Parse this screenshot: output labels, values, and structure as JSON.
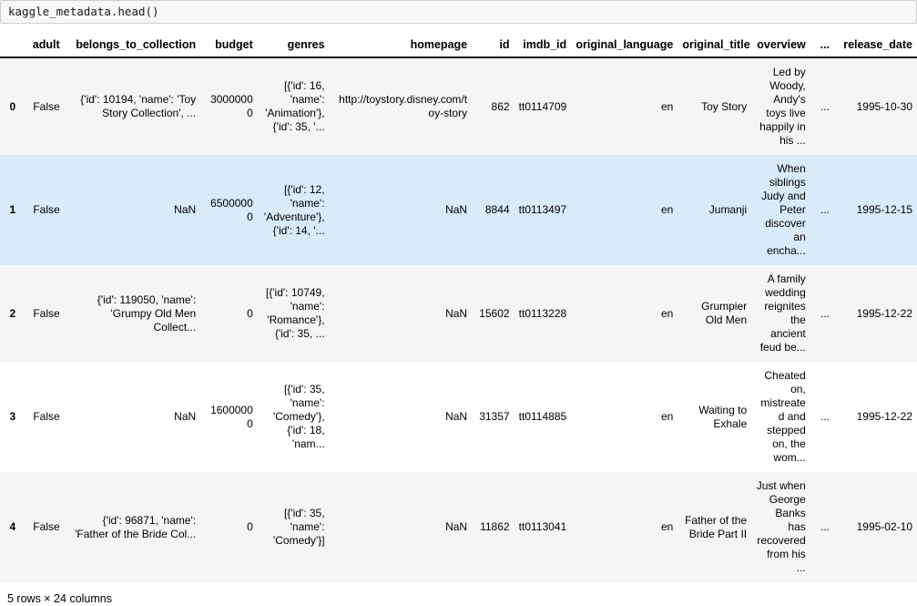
{
  "notebook": {
    "code_cell": {
      "source": "kaggle_metadata.head()"
    },
    "output": {
      "footer": "5 rows × 24 columns"
    }
  },
  "colors": {
    "cell_background": "#f7f7f7",
    "cell_border": "#cfcfcf",
    "row_stripe": "#f5f5f5",
    "row_highlight": "#d9eaf8",
    "header_rule": "#111111",
    "text": "#000000"
  },
  "table": {
    "index_header": "",
    "columns": [
      "adult",
      "belongs_to_collection",
      "budget",
      "genres",
      "homepage",
      "id",
      "imdb_id",
      "original_language",
      "original_title",
      "overview",
      "...",
      "release_date"
    ],
    "rows": [
      {
        "index": "0",
        "adult": "False",
        "belongs_to_collection": "{'id': 10194, 'name': 'Toy Story Collection', ...",
        "budget": "30000000",
        "genres": "[{'id': 16, 'name': 'Animation'}, {'id': 35, '...",
        "homepage": "http://toystory.disney.com/toy-story",
        "id": "862",
        "imdb_id": "tt0114709",
        "original_language": "en",
        "original_title": "Toy Story",
        "overview": "Led by Woody, Andy's toys live happily in his ...",
        "ellipsis": "...",
        "release_date": "1995-10-30",
        "highlighted": false
      },
      {
        "index": "1",
        "adult": "False",
        "belongs_to_collection": "NaN",
        "budget": "65000000",
        "genres": "[{'id': 12, 'name': 'Adventure'}, {'id': 14, '...",
        "homepage": "NaN",
        "id": "8844",
        "imdb_id": "tt0113497",
        "original_language": "en",
        "original_title": "Jumanji",
        "overview": "When siblings Judy and Peter discover an encha...",
        "ellipsis": "...",
        "release_date": "1995-12-15",
        "highlighted": true
      },
      {
        "index": "2",
        "adult": "False",
        "belongs_to_collection": "{'id': 119050, 'name': 'Grumpy Old Men Collect...",
        "budget": "0",
        "genres": "[{'id': 10749, 'name': 'Romance'}, {'id': 35, ...",
        "homepage": "NaN",
        "id": "15602",
        "imdb_id": "tt0113228",
        "original_language": "en",
        "original_title": "Grumpier Old Men",
        "overview": "A family wedding reignites the ancient feud be...",
        "ellipsis": "...",
        "release_date": "1995-12-22",
        "highlighted": false
      },
      {
        "index": "3",
        "adult": "False",
        "belongs_to_collection": "NaN",
        "budget": "16000000",
        "genres": "[{'id': 35, 'name': 'Comedy'}, {'id': 18, 'nam...",
        "homepage": "NaN",
        "id": "31357",
        "imdb_id": "tt0114885",
        "original_language": "en",
        "original_title": "Waiting to Exhale",
        "overview": "Cheated on, mistreated and stepped on, the wom...",
        "ellipsis": "...",
        "release_date": "1995-12-22",
        "highlighted": false
      },
      {
        "index": "4",
        "adult": "False",
        "belongs_to_collection": "{'id': 96871, 'name': 'Father of the Bride Col...",
        "budget": "0",
        "genres": "[{'id': 35, 'name': 'Comedy'}]",
        "homepage": "NaN",
        "id": "11862",
        "imdb_id": "tt0113041",
        "original_language": "en",
        "original_title": "Father of the Bride Part II",
        "overview": "Just when George Banks has recovered from his ...",
        "ellipsis": "...",
        "release_date": "1995-02-10",
        "highlighted": false
      }
    ]
  }
}
